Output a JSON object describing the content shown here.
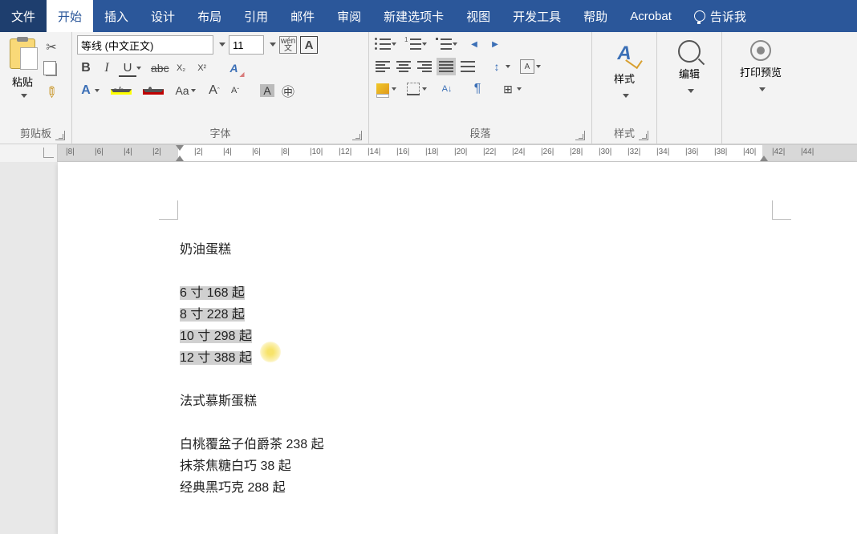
{
  "tabs": {
    "file": "文件",
    "home": "开始",
    "insert": "插入",
    "design": "设计",
    "layout": "布局",
    "references": "引用",
    "mail": "邮件",
    "review": "审阅",
    "newtab": "新建选项卡",
    "view": "视图",
    "developer": "开发工具",
    "help": "帮助",
    "acrobat": "Acrobat",
    "tellme": "告诉我"
  },
  "ribbon": {
    "clipboard": {
      "label": "剪贴板",
      "paste": "粘贴"
    },
    "font": {
      "label": "字体",
      "name": "等线 (中文正文)",
      "size": "11",
      "wen_top": "wén",
      "wen_bot": "文"
    },
    "paragraph": {
      "label": "段落"
    },
    "styles": {
      "label": "样式",
      "btn": "样式"
    },
    "edit": {
      "btn": "编辑"
    },
    "preview": {
      "btn": "打印预览"
    }
  },
  "ruler": {
    "left": [
      "8",
      "6",
      "4",
      "2"
    ],
    "right": [
      "2",
      "4",
      "6",
      "8",
      "10",
      "12",
      "14",
      "16",
      "18",
      "20",
      "22",
      "24",
      "26",
      "28",
      "30",
      "32",
      "34",
      "36",
      "38",
      "40",
      "42",
      "44"
    ]
  },
  "doc": {
    "h1": "奶油蛋糕",
    "rows": [
      "6 寸   168 起",
      "8 寸   228 起",
      "10 寸   298 起",
      "12 寸  388 起"
    ],
    "h2": "法式慕斯蛋糕",
    "items": [
      "白桃覆盆子伯爵茶 238 起",
      "抹茶焦糖白巧 38 起",
      "经典黑巧克 288 起"
    ]
  }
}
